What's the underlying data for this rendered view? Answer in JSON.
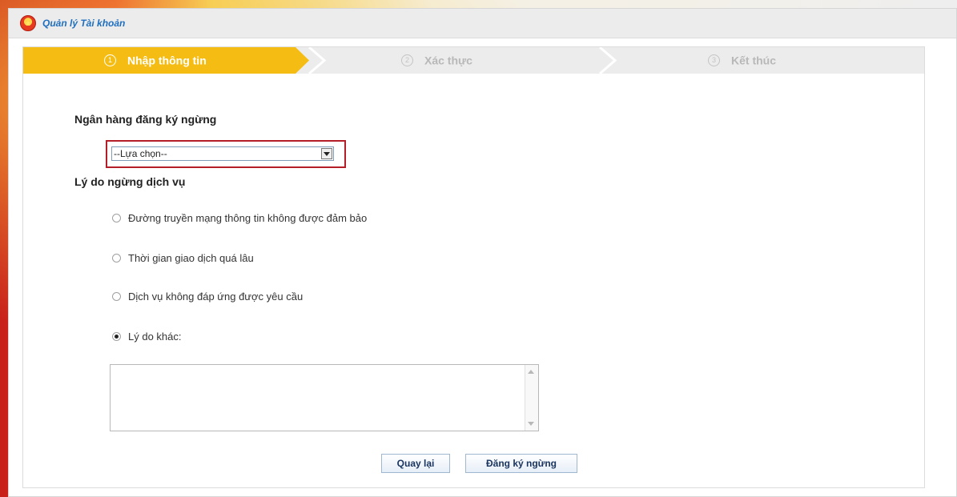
{
  "header": {
    "title": "Quản lý Tài khoản"
  },
  "steps": [
    {
      "num": "1",
      "label": "Nhập thông tin",
      "active": true
    },
    {
      "num": "2",
      "label": "Xác thực",
      "active": false
    },
    {
      "num": "3",
      "label": "Kết thúc",
      "active": false
    }
  ],
  "form": {
    "bank_label": "Ngân hàng đăng ký ngừng",
    "bank_select_value": "--Lựa chọn--",
    "reason_label": "Lý do ngừng dịch vụ",
    "reasons": [
      {
        "label": "Đường truyền mạng thông tin không được đảm bảo",
        "checked": false
      },
      {
        "label": "Thời gian giao dịch quá lâu",
        "checked": false
      },
      {
        "label": "Dịch vụ không đáp ứng được yêu cầu",
        "checked": false
      },
      {
        "label": "Lý do khác:",
        "checked": true
      }
    ],
    "other_reason_value": ""
  },
  "buttons": {
    "back_label": "Quay lại",
    "submit_label": "Đăng ký ngừng"
  },
  "colors": {
    "active_step": "#f5bd13",
    "inactive_step": "#ececec",
    "highlight": "#b31e28",
    "title_blue": "#1f6fbf"
  }
}
